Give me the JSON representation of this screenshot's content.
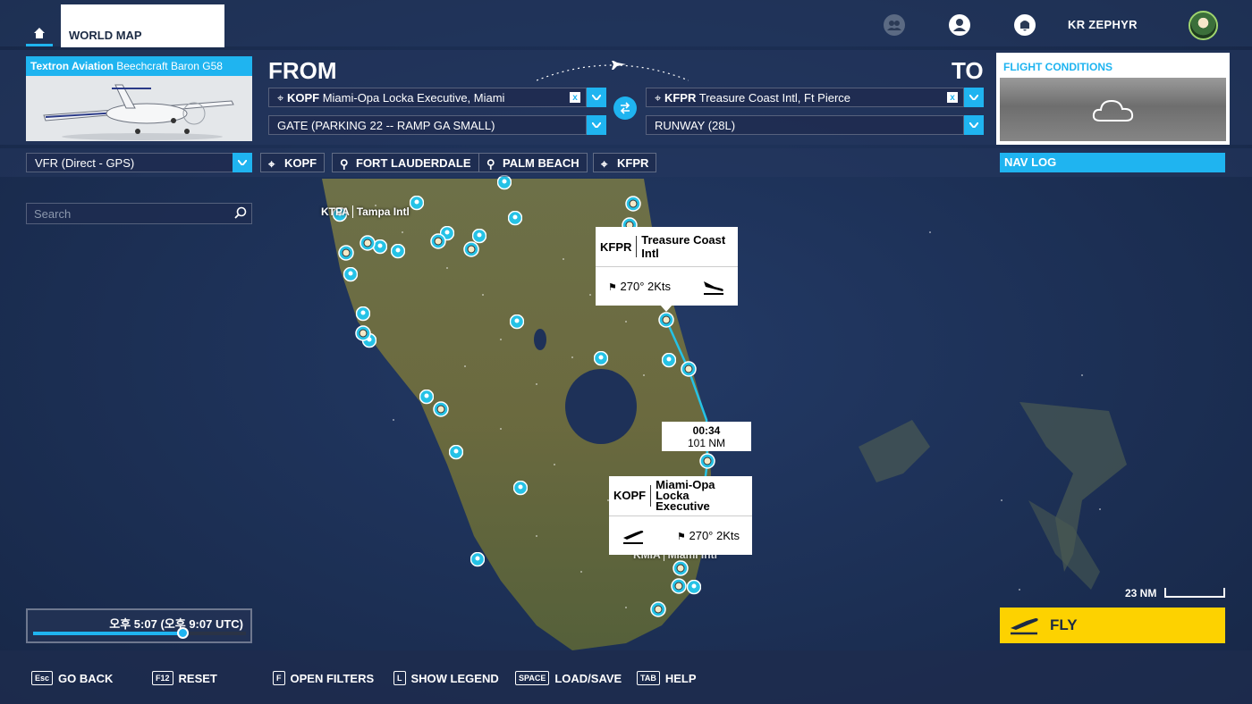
{
  "header": {
    "tab_world_map": "WORLD MAP",
    "user_name": "KR ZEPHYR"
  },
  "aircraft": {
    "maker": "Textron Aviation",
    "model": "Beechcraft Baron G58"
  },
  "flight": {
    "from_label": "FROM",
    "to_label": "TO",
    "from_code": "KOPF",
    "from_name": "Miami-Opa Locka Executive, Miami",
    "from_start": "GATE (PARKING 22 -- RAMP GA SMALL)",
    "to_code": "KFPR",
    "to_name": "Treasure Coast Intl, Ft Pierce",
    "to_arrival": "RUNWAY (28L)",
    "clear_glyph": "x"
  },
  "conditions": {
    "title": "FLIGHT CONDITIONS"
  },
  "route": {
    "flight_type": "VFR (Direct - GPS)",
    "waypoints": [
      "KOPF",
      "FORT LAUDERDALE",
      "PALM BEACH",
      "KFPR"
    ],
    "nav_log": "NAV LOG"
  },
  "search": {
    "placeholder": "Search"
  },
  "map": {
    "ktpa_code": "KTPA",
    "ktpa_name": "Tampa Intl",
    "kmia_code": "KMIA",
    "kmia_name": "Miami Intl",
    "leg_time": "00:34",
    "leg_distance": "101 NM",
    "scale_label": "23 NM"
  },
  "dest_popup": {
    "code": "KFPR",
    "name": "Treasure Coast Intl",
    "wind": "270° 2Kts"
  },
  "origin_popup": {
    "code": "KOPF",
    "name_line1": "Miami-Opa Locka",
    "name_line2": "Executive",
    "wind": "270° 2Kts"
  },
  "time": {
    "local_prefix": "오후",
    "local_time": "5:07",
    "utc_prefix": "(오후",
    "utc_time": "9:07 UTC)",
    "slider_fraction": 0.7
  },
  "fly_button": "FLY",
  "footer": [
    {
      "key": "Esc",
      "label": "GO BACK"
    },
    {
      "key": "F12",
      "label": "RESET"
    },
    {
      "key": "F",
      "label": "OPEN FILTERS"
    },
    {
      "key": "L",
      "label": "SHOW LEGEND"
    },
    {
      "key": "SPACE",
      "label": "LOAD/SAVE"
    },
    {
      "key": "TAB",
      "label": "HELP"
    }
  ],
  "colors": {
    "accent": "#1fb4f0",
    "fly": "#fdd200",
    "ocean": "#1e3158",
    "land": "#5b6b3e"
  }
}
